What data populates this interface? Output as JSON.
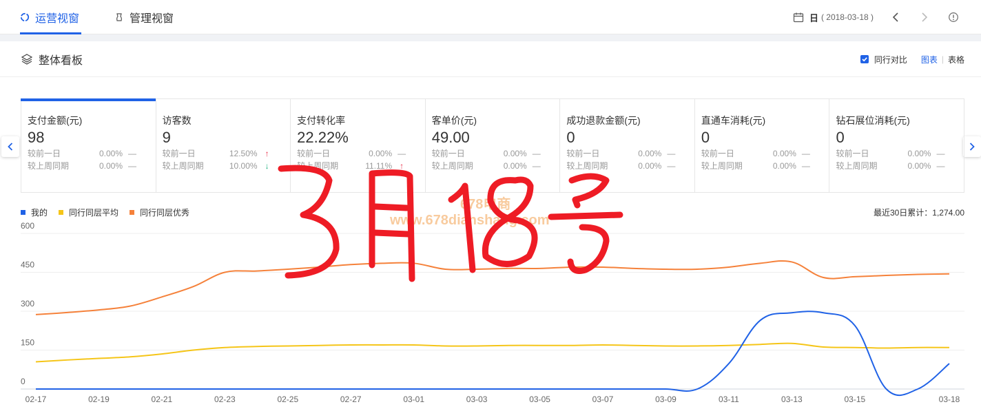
{
  "nav": {
    "tabs": [
      {
        "label": "运营视窗",
        "active": true
      },
      {
        "label": "管理视窗",
        "active": false
      }
    ],
    "day_label": "日",
    "date": "( 2018-03-18 )"
  },
  "section": {
    "title": "整体看板",
    "compare_label": "同行对比",
    "compare_checked": true,
    "view_chart": "图表",
    "view_table": "表格"
  },
  "metrics": [
    {
      "label": "支付金额(元)",
      "value": "98",
      "cmp": [
        {
          "label": "较前一日",
          "value": "0.00%",
          "trend": "—"
        },
        {
          "label": "较上周同期",
          "value": "0.00%",
          "trend": "—"
        }
      ]
    },
    {
      "label": "访客数",
      "value": "9",
      "cmp": [
        {
          "label": "较前一日",
          "value": "12.50%",
          "trend": "↑"
        },
        {
          "label": "较上周同期",
          "value": "10.00%",
          "trend": "↓"
        }
      ]
    },
    {
      "label": "支付转化率",
      "value": "22.22%",
      "cmp": [
        {
          "label": "较前一日",
          "value": "0.00%",
          "trend": "—"
        },
        {
          "label": "较上周同期",
          "value": "11.11%",
          "trend": "↑"
        }
      ]
    },
    {
      "label": "客单价(元)",
      "value": "49.00",
      "cmp": [
        {
          "label": "较前一日",
          "value": "0.00%",
          "trend": "—"
        },
        {
          "label": "较上周同期",
          "value": "0.00%",
          "trend": "—"
        }
      ]
    },
    {
      "label": "成功退款金额(元)",
      "value": "0",
      "cmp": [
        {
          "label": "较前一日",
          "value": "0.00%",
          "trend": "—"
        },
        {
          "label": "较上周同期",
          "value": "0.00%",
          "trend": "—"
        }
      ]
    },
    {
      "label": "直通车消耗(元)",
      "value": "0",
      "cmp": [
        {
          "label": "较前一日",
          "value": "0.00%",
          "trend": "—"
        },
        {
          "label": "较上周同期",
          "value": "0.00%",
          "trend": "—"
        }
      ]
    },
    {
      "label": "钻石展位消耗(元)",
      "value": "0",
      "cmp": [
        {
          "label": "较前一日",
          "value": "0.00%",
          "trend": "—"
        },
        {
          "label": "较上周同期",
          "value": "0.00%",
          "trend": "—"
        }
      ]
    }
  ],
  "colors": {
    "accent": "#2062e6",
    "up": "#e8304a",
    "down": "#1db27e",
    "mine": "#2062e6",
    "avg": "#f5c518",
    "excellent": "#f5813a",
    "handwriting": "#ee1c25"
  },
  "overlay": {
    "handwriting_text": "3月18号",
    "watermark_1": "678电商",
    "watermark_2": "www.678dianshang.com"
  },
  "total_text": "最近30日累计：1,274.00",
  "chart_data": {
    "type": "line",
    "x": [
      "02-17",
      "02-18",
      "02-19",
      "02-20",
      "02-21",
      "02-22",
      "02-23",
      "02-24",
      "02-25",
      "02-26",
      "02-27",
      "02-28",
      "03-01",
      "03-02",
      "03-03",
      "03-04",
      "03-05",
      "03-06",
      "03-07",
      "03-08",
      "03-09",
      "03-10",
      "03-11",
      "03-12",
      "03-13",
      "03-14",
      "03-15",
      "03-16",
      "03-17",
      "03-18"
    ],
    "xticks": [
      "02-17",
      "02-19",
      "02-21",
      "02-23",
      "02-25",
      "02-27",
      "03-01",
      "03-03",
      "03-05",
      "03-07",
      "03-09",
      "03-11",
      "03-13",
      "03-15",
      "03-18"
    ],
    "yticks": [
      0,
      150,
      300,
      450,
      600
    ],
    "ylim": [
      0,
      600
    ],
    "grid": true,
    "legend_position": "top-left",
    "series": [
      {
        "name": "我的",
        "color": "#2062e6",
        "values": [
          0,
          0,
          0,
          0,
          0,
          0,
          0,
          0,
          0,
          0,
          0,
          0,
          0,
          0,
          0,
          0,
          0,
          0,
          0,
          0,
          0,
          0,
          98,
          265,
          294,
          294,
          245,
          0,
          0,
          98
        ]
      },
      {
        "name": "同行同层平均",
        "color": "#f5c518",
        "values": [
          105,
          112,
          118,
          124,
          135,
          150,
          160,
          164,
          166,
          168,
          170,
          170,
          170,
          166,
          166,
          168,
          168,
          168,
          170,
          168,
          166,
          166,
          168,
          172,
          176,
          162,
          160,
          158,
          160,
          160
        ]
      },
      {
        "name": "同行同层优秀",
        "color": "#f5813a",
        "values": [
          287,
          295,
          305,
          320,
          355,
          395,
          450,
          455,
          462,
          470,
          480,
          485,
          485,
          462,
          462,
          465,
          465,
          470,
          470,
          465,
          462,
          462,
          470,
          485,
          490,
          430,
          433,
          438,
          442,
          444
        ]
      }
    ]
  }
}
